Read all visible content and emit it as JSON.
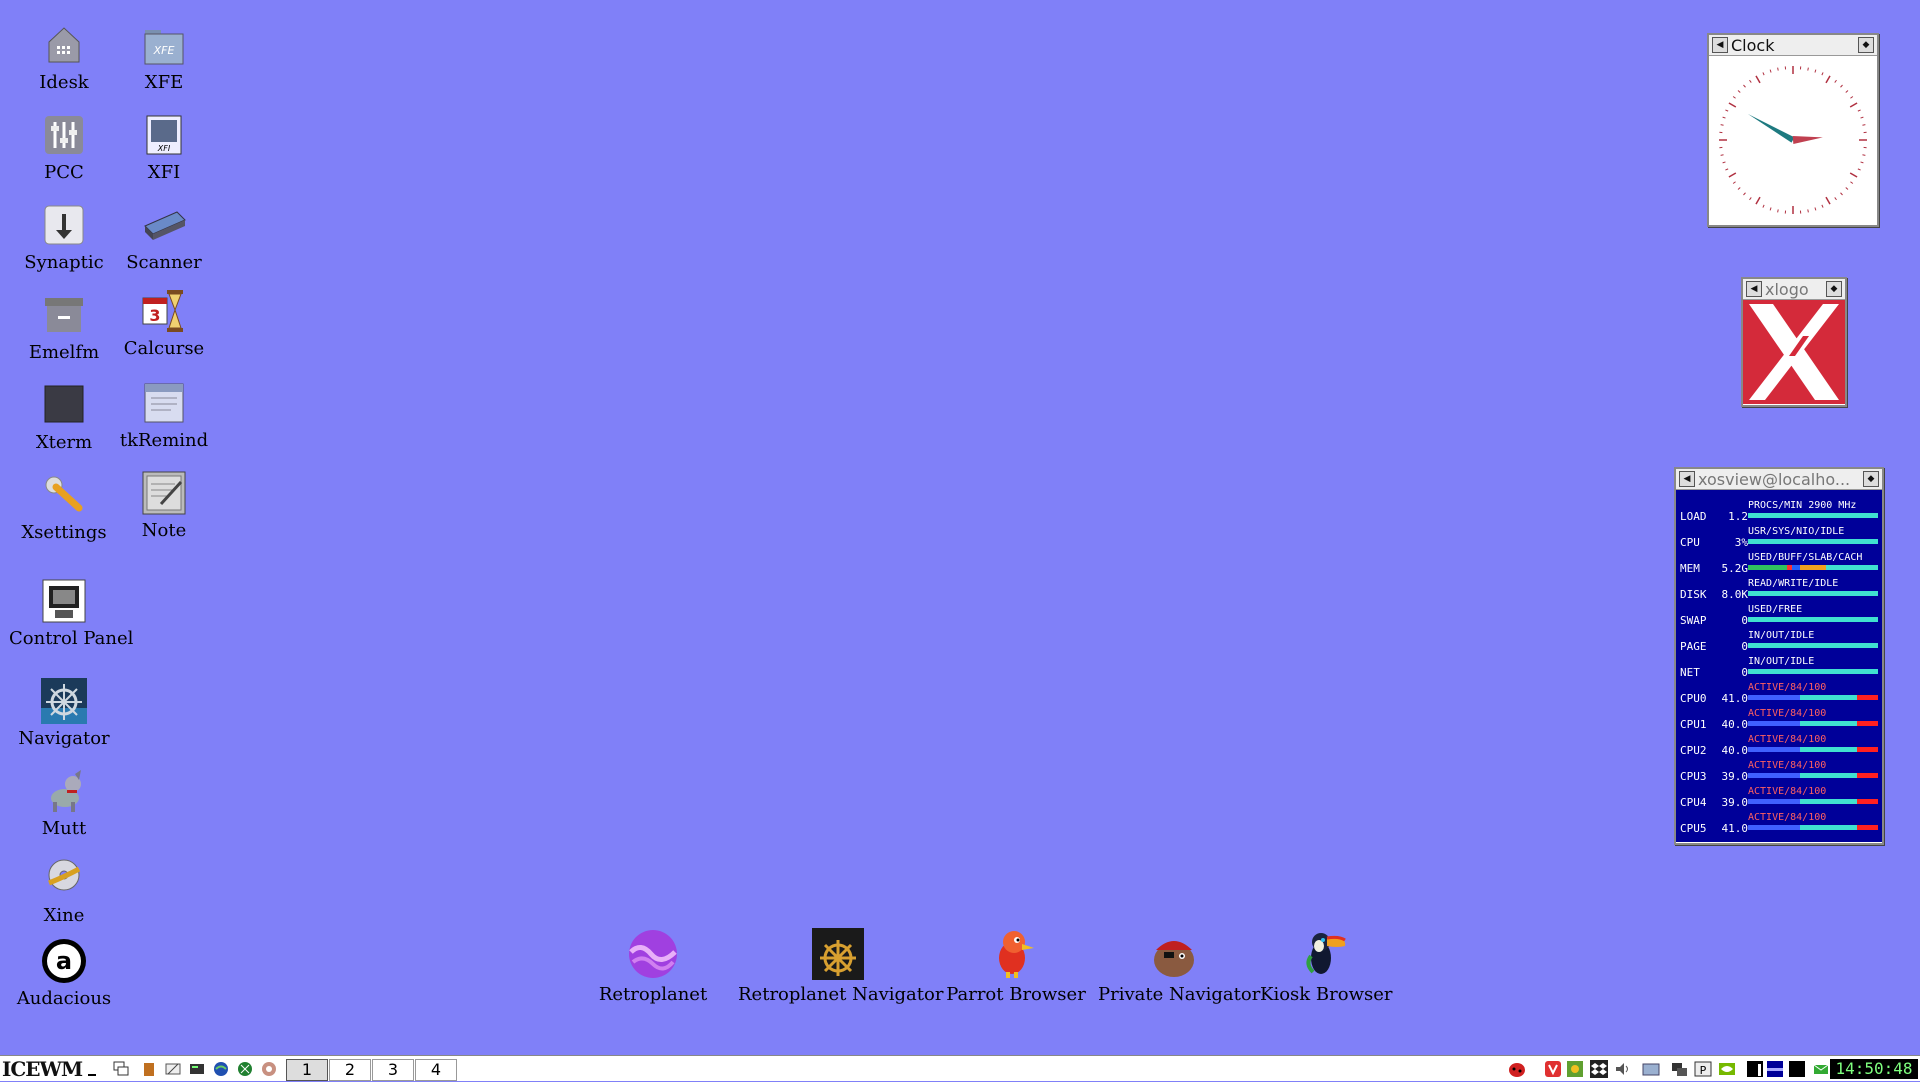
{
  "desktop_icons": {
    "idesk": "Idesk",
    "xfe": "XFE",
    "pcc": "PCC",
    "xfi": "XFI",
    "synaptic": "Synaptic",
    "scanner": "Scanner",
    "emelfm": "Emelfm",
    "calcurse": "Calcurse",
    "xterm": "Xterm",
    "tkremind": "tkRemind",
    "xsettings": "Xsettings",
    "note": "Note",
    "control_panel": "Control Panel",
    "navigator": "Navigator",
    "mutt": "Mutt",
    "xine": "Xine",
    "audacious": "Audacious"
  },
  "dock": {
    "retroplanet": "Retroplanet",
    "retroplanet_navigator": "Retroplanet Navigator",
    "parrot_browser": "Parrot Browser",
    "private_navigator": "Private Navigator",
    "kiosk_browser": "Kiosk Browser"
  },
  "clock_window": {
    "title": "Clock",
    "hour": 14,
    "minute": 50
  },
  "xlogo_window": {
    "title": "xlogo"
  },
  "xosview": {
    "title": "xosview@localho...",
    "rows": [
      {
        "name": "LOAD",
        "value": "1.2",
        "legend": "PROCS/MIN 2900 MHz"
      },
      {
        "name": "CPU",
        "value": "3%",
        "legend": "USR/SYS/NIO/IDLE"
      },
      {
        "name": "MEM",
        "value": "5.2G",
        "legend": "USED/BUFF/SLAB/CACH"
      },
      {
        "name": "DISK",
        "value": "8.0K",
        "legend": "READ/WRITE/IDLE"
      },
      {
        "name": "SWAP",
        "value": "0",
        "legend": "USED/FREE"
      },
      {
        "name": "PAGE",
        "value": "0",
        "legend": "IN/OUT/IDLE"
      },
      {
        "name": "NET",
        "value": "0",
        "legend": "IN/OUT/IDLE"
      },
      {
        "name": "CPU0",
        "value": "41.0",
        "legend": "ACTIVE/84/100"
      },
      {
        "name": "CPU1",
        "value": "40.0",
        "legend": "ACTIVE/84/100"
      },
      {
        "name": "CPU2",
        "value": "40.0",
        "legend": "ACTIVE/84/100"
      },
      {
        "name": "CPU3",
        "value": "39.0",
        "legend": "ACTIVE/84/100"
      },
      {
        "name": "CPU4",
        "value": "39.0",
        "legend": "ACTIVE/84/100"
      },
      {
        "name": "CPU5",
        "value": "41.0",
        "legend": "ACTIVE/84/100"
      }
    ]
  },
  "taskbar": {
    "logo": "ICEWM",
    "workspaces": [
      "1",
      "2",
      "3",
      "4"
    ],
    "time": "14:50:48"
  },
  "colors": {
    "desktop": "#8080f8",
    "xosview_bg": "#000099",
    "xlogo_red": "#d42a3a"
  }
}
